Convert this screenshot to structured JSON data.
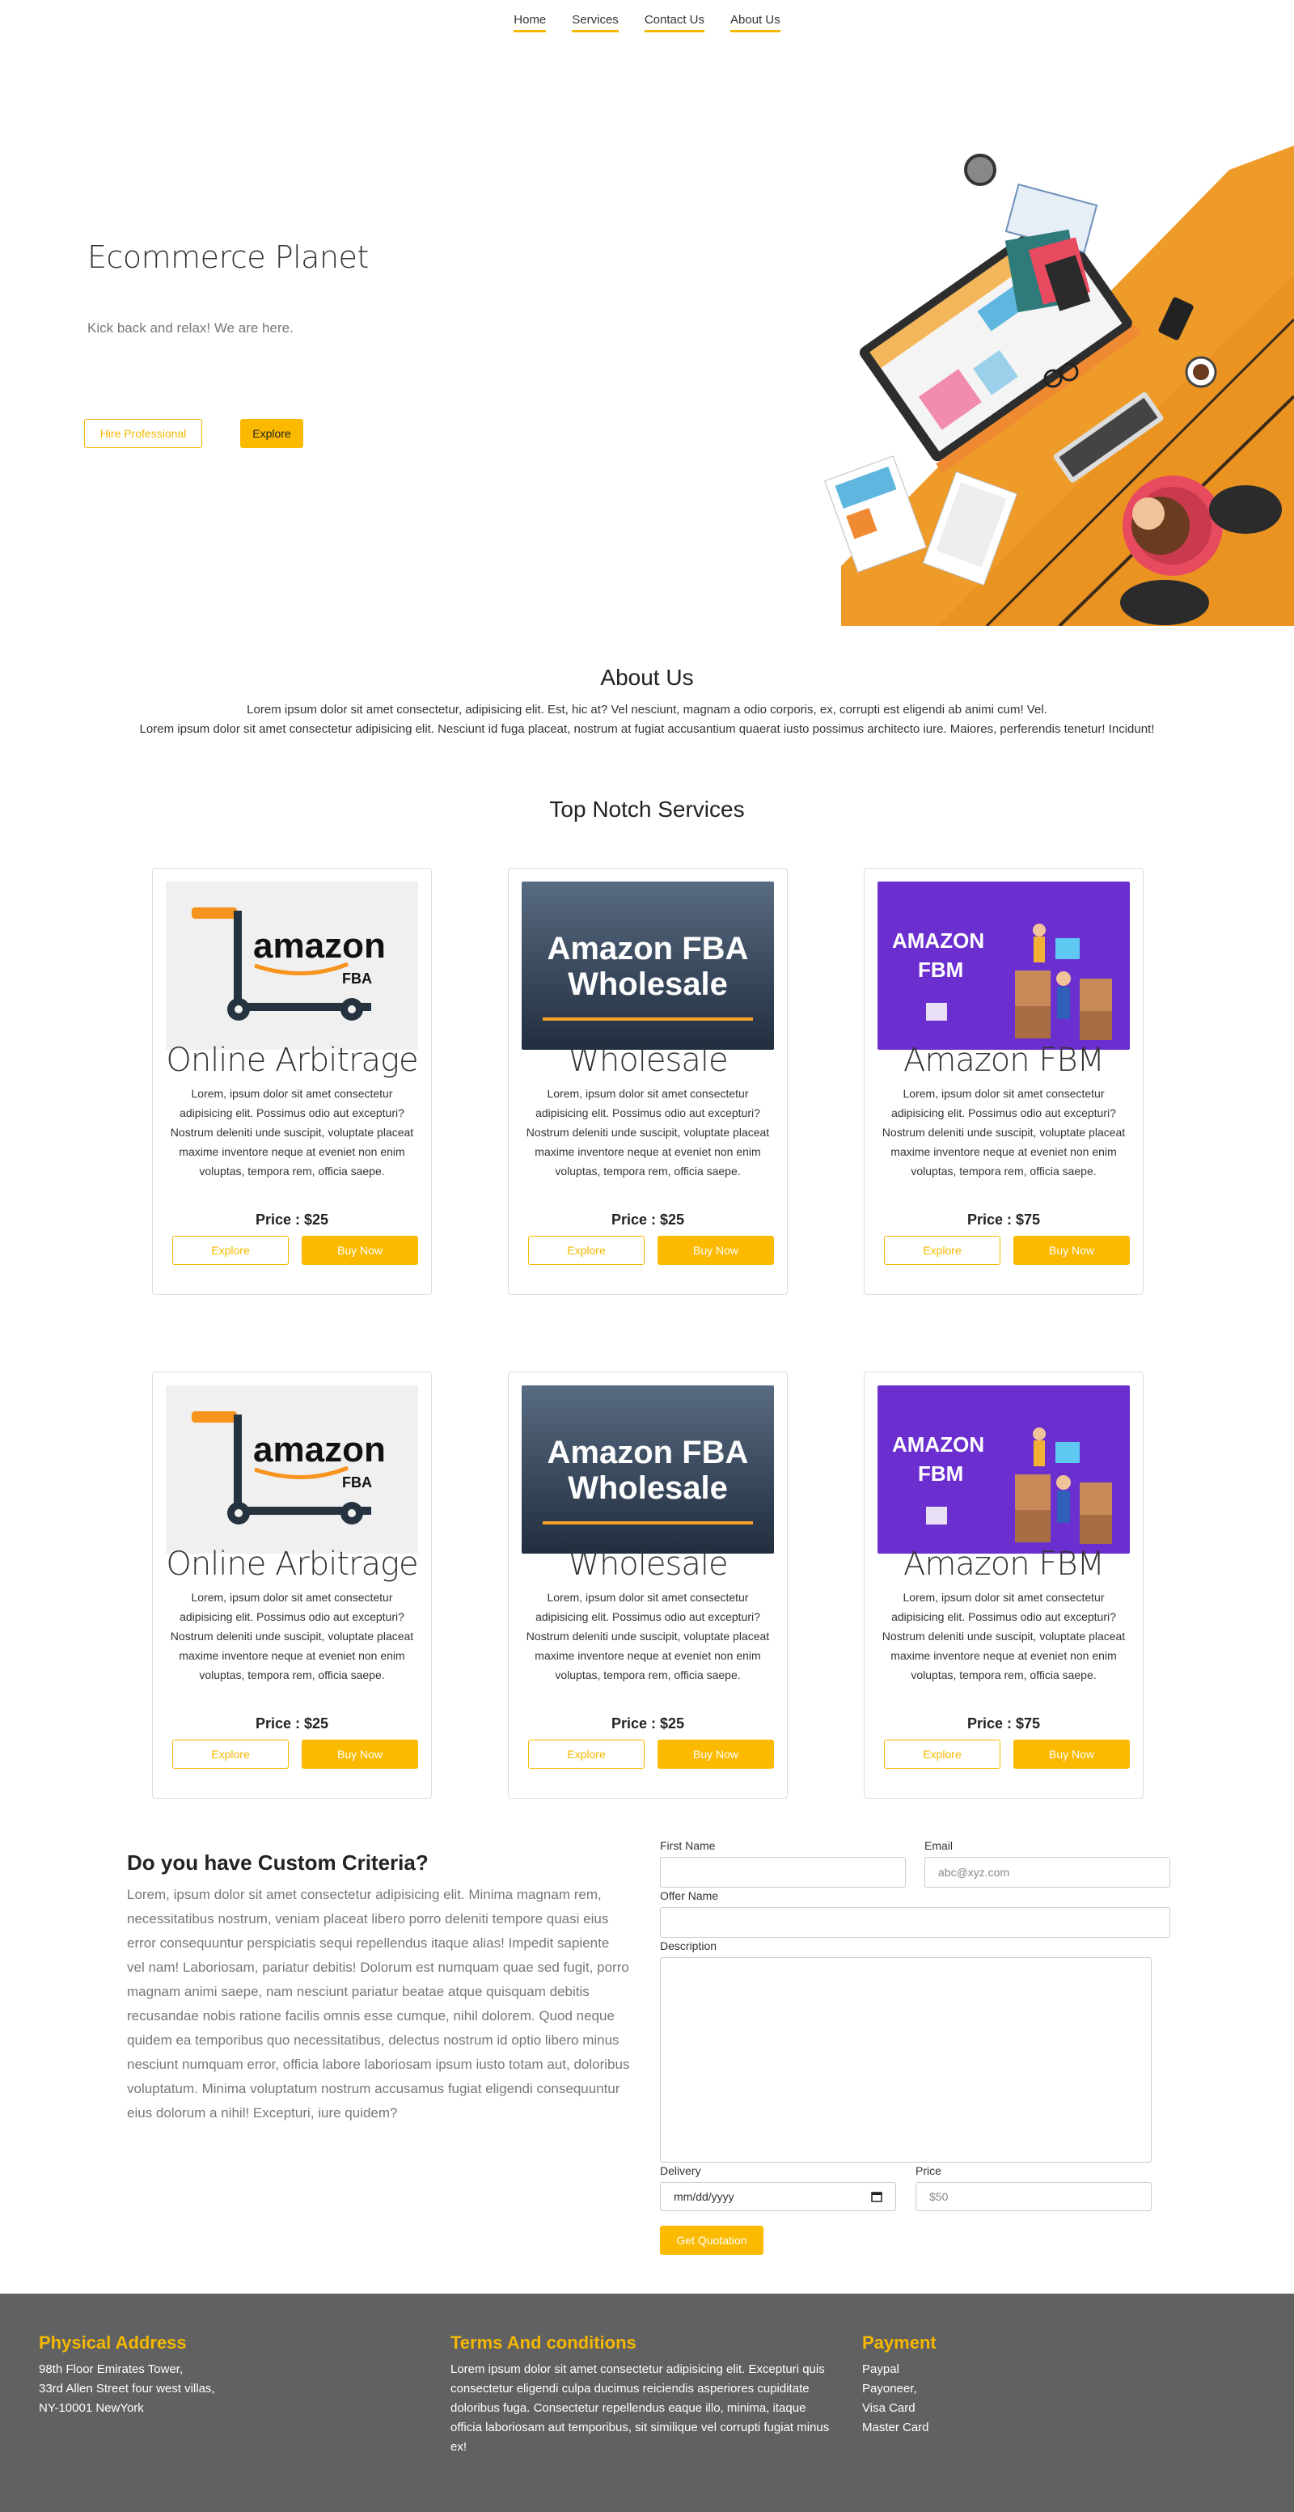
{
  "nav": [
    "Home",
    "Services",
    "Contact Us",
    "About Us"
  ],
  "hero": {
    "title": "Ecommerce Planet",
    "subtitle": "Kick back and relax! We are here.",
    "btn_hire": "Hire Professional",
    "btn_explore": "Explore"
  },
  "about": {
    "title": "About Us",
    "line1": "Lorem ipsum dolor sit amet consectetur, adipisicing elit. Est, hic at? Vel nesciunt, magnam a odio corporis, ex, corrupti est eligendi ab animi cum! Vel.",
    "line2": "Lorem ipsum dolor sit amet consectetur adipisicing elit. Nesciunt id fuga placeat, nostrum at fugiat accusantium quaerat iusto possimus architecto iure. Maiores, perferendis tenetur! Incidunt!"
  },
  "services_title": "Top Notch Services",
  "cards": [
    {
      "title": "Online Arbitrage",
      "desc": "Lorem, ipsum dolor sit amet consectetur adipisicing elit. Possimus odio aut excepturi? Nostrum deleniti unde suscipit, voluptate placeat maxime inventore neque at eveniet non enim voluptas, tempora rem, officia saepe.",
      "price": "Price : $25",
      "btn1": "Explore",
      "btn2": "Buy Now",
      "img": "amazon-fba-icon"
    },
    {
      "title": "Wholesale",
      "desc": "Lorem, ipsum dolor sit amet consectetur adipisicing elit. Possimus odio aut excepturi? Nostrum deleniti unde suscipit, voluptate placeat maxime inventore neque at eveniet non enim voluptas, tempora rem, officia saepe.",
      "price": "Price : $25",
      "btn1": "Explore",
      "btn2": "Buy Now",
      "img": "fba-wholesale-banner"
    },
    {
      "title": "Amazon FBM",
      "desc": "Lorem, ipsum dolor sit amet consectetur adipisicing elit. Possimus odio aut excepturi? Nostrum deleniti unde suscipit, voluptate placeat maxime inventore neque at eveniet non enim voluptas, tempora rem, officia saepe.",
      "price": "Price : $75",
      "btn1": "Explore",
      "btn2": "Buy Now",
      "img": "amazon-fbm-illustration"
    },
    {
      "title": "Online Arbitrage",
      "desc": "Lorem, ipsum dolor sit amet consectetur adipisicing elit. Possimus odio aut excepturi? Nostrum deleniti unde suscipit, voluptate placeat maxime inventore neque at eveniet non enim voluptas, tempora rem, officia saepe.",
      "price": "Price : $25",
      "btn1": "Explore",
      "btn2": "Buy Now",
      "img": "amazon-fba-icon"
    },
    {
      "title": "Wholesale",
      "desc": "Lorem, ipsum dolor sit amet consectetur adipisicing elit. Possimus odio aut excepturi? Nostrum deleniti unde suscipit, voluptate placeat maxime inventore neque at eveniet non enim voluptas, tempora rem, officia saepe.",
      "price": "Price : $25",
      "btn1": "Explore",
      "btn2": "Buy Now",
      "img": "fba-wholesale-banner"
    },
    {
      "title": "Amazon FBM",
      "desc": "Lorem, ipsum dolor sit amet consectetur adipisicing elit. Possimus odio aut excepturi? Nostrum deleniti unde suscipit, voluptate placeat maxime inventore neque at eveniet non enim voluptas, tempora rem, officia saepe.",
      "price": "Price : $75",
      "btn1": "Explore",
      "btn2": "Buy Now",
      "img": "amazon-fbm-illustration"
    }
  ],
  "image_text": {
    "amazon": "amazon",
    "fba": "FBA",
    "fba_wholesale_1": "Amazon FBA",
    "fba_wholesale_2": "Wholesale",
    "fbm_1": "AMAZON",
    "fbm_2": "FBM"
  },
  "custom": {
    "title": "Do you have Custom Criteria?",
    "text": "Lorem, ipsum dolor sit amet consectetur adipisicing elit. Minima magnam rem, necessitatibus nostrum, veniam placeat libero porro deleniti tempore quasi eius error consequuntur perspiciatis sequi repellendus itaque alias! Impedit sapiente vel nam! Laboriosam, pariatur debitis! Dolorum est numquam quae sed fugit, porro magnam animi saepe, nam nesciunt pariatur beatae atque quisquam debitis recusandae nobis ratione facilis omnis esse cumque, nihil dolorem. Quod neque quidem ea temporibus quo necessitatibus, delectus nostrum id optio libero minus nesciunt numquam error, officia labore laboriosam ipsum iusto totam aut, doloribus voluptatum. Minima voluptatum nostrum accusamus fugiat eligendi consequuntur eius dolorum a nihil! Excepturi, iure quidem?"
  },
  "form": {
    "first_name_label": "First Name",
    "first_name_value": "",
    "email_label": "Email",
    "email_placeholder": "abc@xyz.com",
    "offer_label": "Offer Name",
    "offer_value": "",
    "description_label": "Description",
    "description_value": "",
    "delivery_label": "Delivery",
    "delivery_placeholder": "mm/dd/yyyy",
    "price_label": "Price",
    "price_placeholder": "$50",
    "submit": "Get Quotation"
  },
  "footer": {
    "address_title": "Physical Address",
    "address_lines": [
      "98th Floor Emirates Tower,",
      "33rd Allen Street four west villas,",
      "NY-10001 NewYork"
    ],
    "terms_title": "Terms And conditions",
    "terms_text": "Lorem ipsum dolor sit amet consectetur adipisicing elit. Excepturi quis consectetur eligendi culpa ducimus reiciendis asperiores cupiditate doloribus fuga. Consectetur repellendus eaque illo, minima, itaque officia laboriosam aut temporibus, sit similique vel corrupti fugiat minus ex!",
    "payment_title": "Payment",
    "payment_lines": [
      "Paypal",
      "Payoneer,",
      "Visa Card",
      "Master Card"
    ]
  },
  "colors": {
    "accent": "#fbba00",
    "footer_bg": "#616161",
    "footer_head": "#f5b800"
  }
}
